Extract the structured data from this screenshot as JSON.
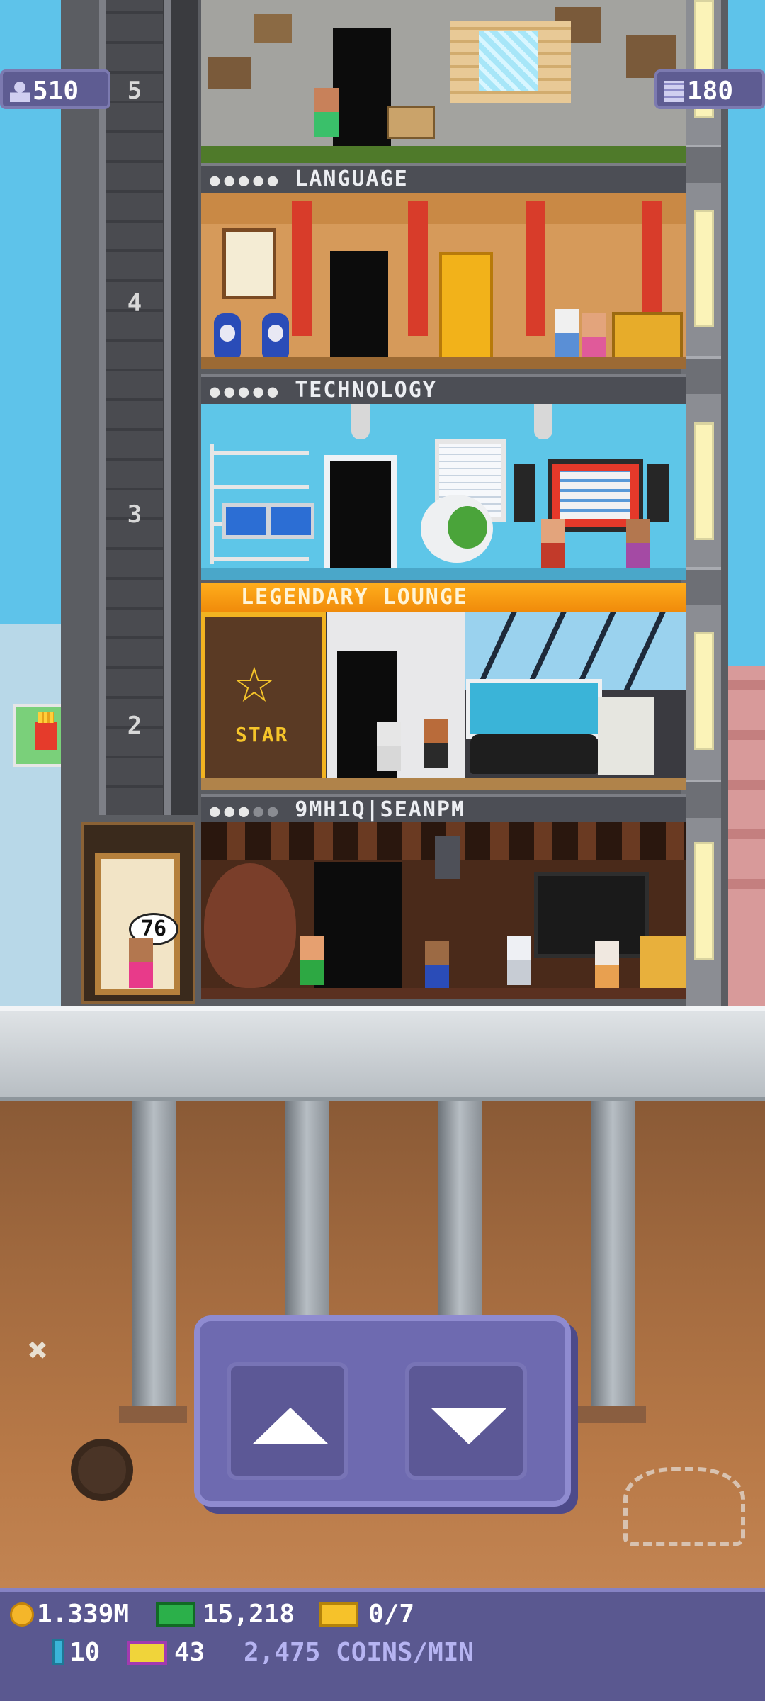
{
  "badges": {
    "population": "510",
    "floors": "180"
  },
  "shaft_floor_numbers": [
    "5",
    "4",
    "3",
    "2"
  ],
  "floors": [
    {
      "name": "",
      "type": "quarry"
    },
    {
      "name": "LANGUAGE",
      "type": "egyptian",
      "people_filled": 5,
      "people_total": 5
    },
    {
      "name": "TECHNOLOGY",
      "type": "tech",
      "people_filled": 5,
      "people_total": 5
    },
    {
      "name": "LEGENDARY LOUNGE",
      "type": "legendary"
    },
    {
      "name": "9MH1Q|SEANPM",
      "type": "chocolate",
      "people_filled": 3,
      "people_total": 5
    }
  ],
  "legendary_sign": "STAR",
  "lobby_elevator": {
    "floor_display": "76"
  },
  "elevator_controls": {
    "up_icon": "up-arrow-icon",
    "down_icon": "down-arrow-icon"
  },
  "status_bar": {
    "coins": "1.339M",
    "bux": "15,218",
    "tickets": "0/7",
    "bux_small": "10",
    "vip": "43",
    "coin_rate": "2,475 COINS/MIN"
  },
  "colors": {
    "sky": "#5ec3ea",
    "legendary_bar": "#f79a12",
    "panel": "#6e6ab0",
    "status_bar": "#5a5890"
  }
}
